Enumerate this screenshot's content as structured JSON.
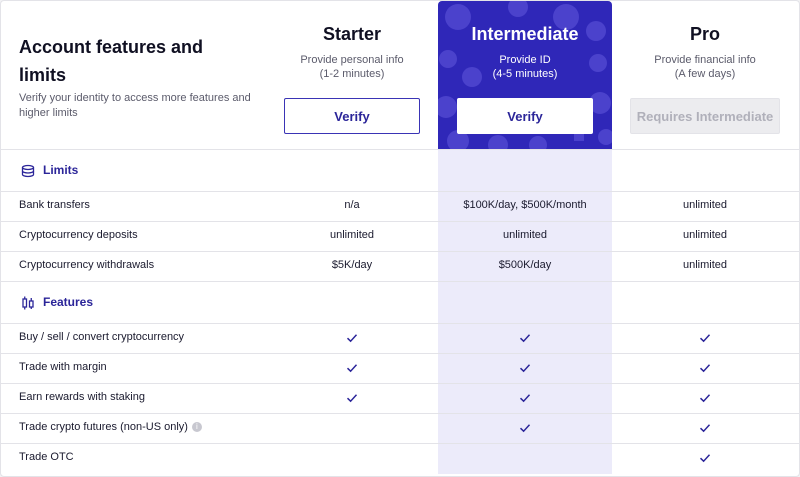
{
  "header": {
    "title": "Account features and limits",
    "subtitle": "Verify your identity to access more features and higher limits"
  },
  "plans": [
    {
      "name": "Starter",
      "sub_line1": "Provide personal info",
      "sub_line2": "(1-2 minutes)",
      "button": "Verify"
    },
    {
      "name": "Intermediate",
      "sub_line1": "Provide ID",
      "sub_line2": "(4-5 minutes)",
      "button": "Verify"
    },
    {
      "name": "Pro",
      "sub_line1": "Provide financial info",
      "sub_line2": "(A few days)",
      "button": "Requires Intermediate"
    }
  ],
  "sections": {
    "limits": {
      "label": "Limits",
      "icon": "coins-icon"
    },
    "features": {
      "label": "Features",
      "icon": "candlestick-icon"
    }
  },
  "limits_rows": [
    {
      "name": "Bank transfers",
      "values": [
        "n/a",
        "$100K/day, $500K/month",
        "unlimited"
      ]
    },
    {
      "name": "Cryptocurrency deposits",
      "values": [
        "unlimited",
        "unlimited",
        "unlimited"
      ]
    },
    {
      "name": "Cryptocurrency withdrawals",
      "values": [
        "$5K/day",
        "$500K/day",
        "unlimited"
      ]
    }
  ],
  "features_rows": [
    {
      "name": "Buy / sell / convert cryptocurrency",
      "checks": [
        true,
        true,
        true
      ]
    },
    {
      "name": "Trade with margin",
      "checks": [
        true,
        true,
        true
      ]
    },
    {
      "name": "Earn rewards with staking",
      "checks": [
        true,
        true,
        true
      ]
    },
    {
      "name": "Trade crypto futures (non-US only)",
      "checks": [
        false,
        true,
        true
      ],
      "info": "i"
    },
    {
      "name": "Trade OTC",
      "checks": [
        false,
        false,
        true
      ]
    }
  ],
  "colors": {
    "accent": "#2f27b8",
    "highlight": "#ecebfa"
  }
}
